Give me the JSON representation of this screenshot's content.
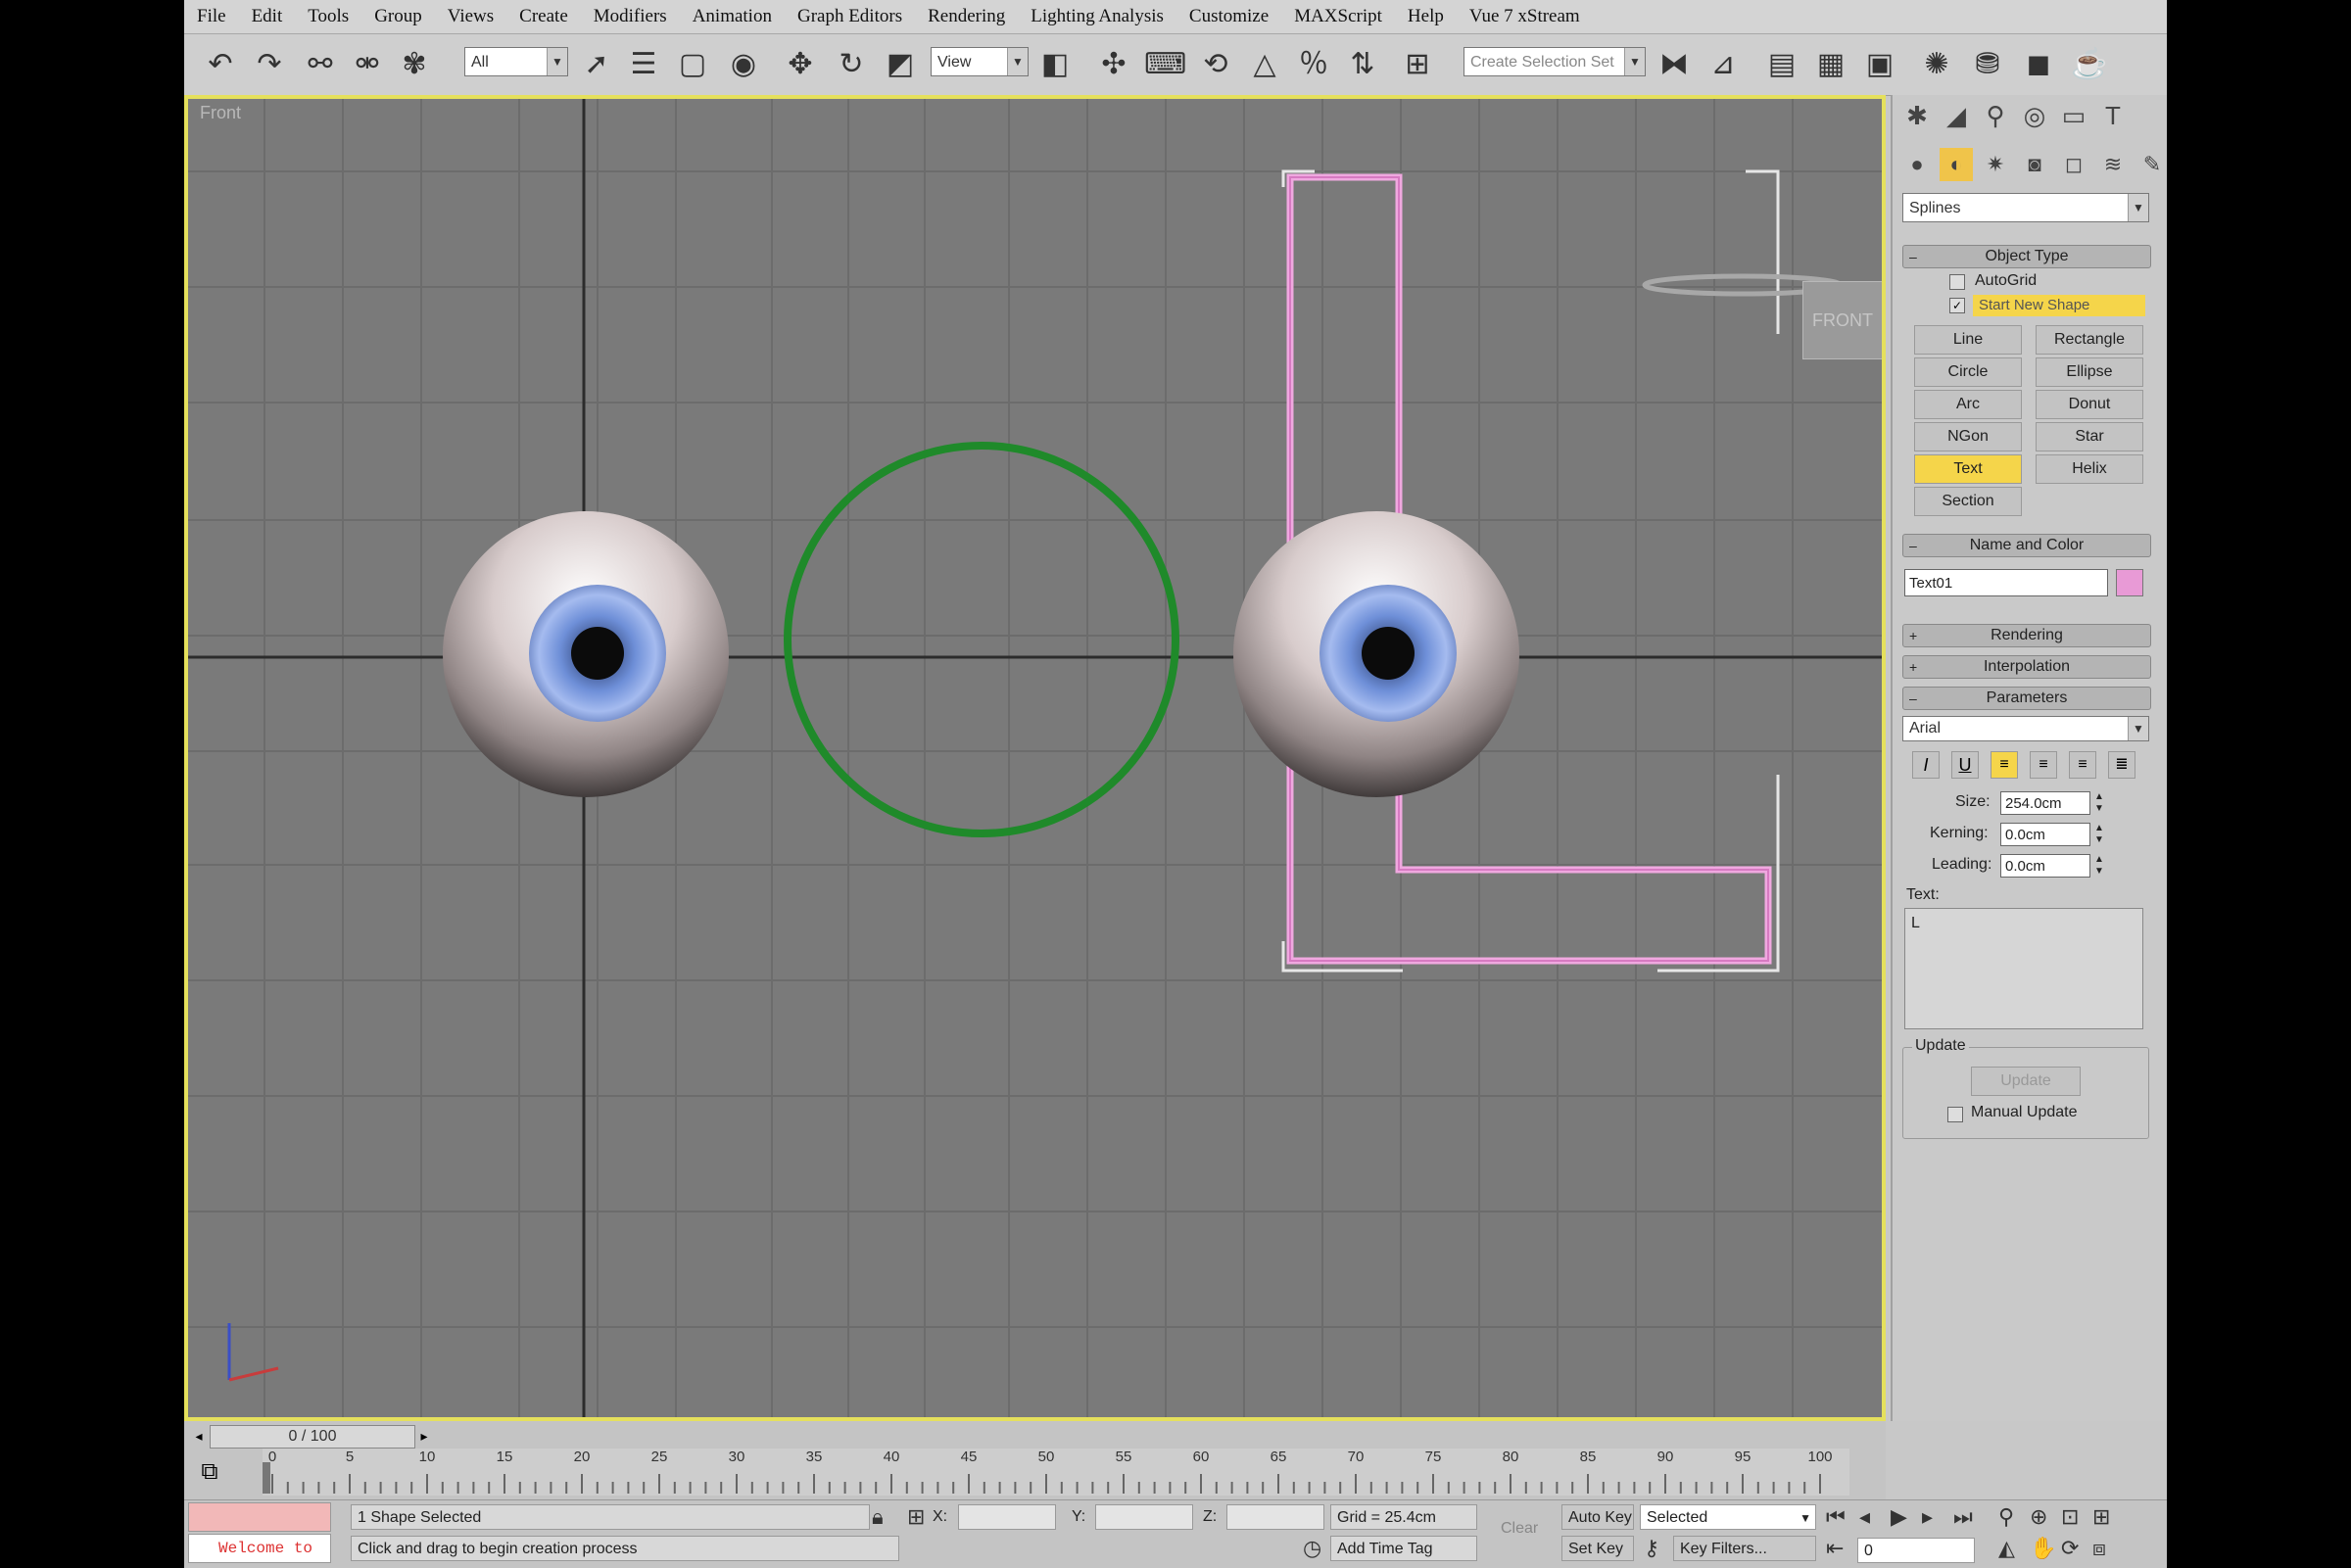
{
  "menu": [
    "File",
    "Edit",
    "Tools",
    "Group",
    "Views",
    "Create",
    "Modifiers",
    "Animation",
    "Graph Editors",
    "Rendering",
    "Lighting Analysis",
    "Customize",
    "MAXScript",
    "Help",
    "Vue 7 xStream"
  ],
  "toolbar": {
    "selection_filter": "All",
    "ref_coord": "View",
    "named_selection_placeholder": "Create Selection Set"
  },
  "viewport": {
    "label": "Front",
    "navcube_label": "FRONT"
  },
  "command_panel": {
    "category": "Splines",
    "object_type": {
      "title": "Object Type",
      "autogrid_label": "AutoGrid",
      "autogrid_checked": false,
      "start_new_shape_label": "Start New Shape",
      "start_new_shape_checked": true,
      "buttons": [
        "Line",
        "Rectangle",
        "Circle",
        "Ellipse",
        "Arc",
        "Donut",
        "NGon",
        "Star",
        "Text",
        "Helix",
        "Section"
      ],
      "active_button": "Text"
    },
    "name_and_color": {
      "title": "Name and Color",
      "object_name": "Text01",
      "color": "#e89ad6"
    },
    "rendering_title": "Rendering",
    "interpolation_title": "Interpolation",
    "parameters": {
      "title": "Parameters",
      "font": "Arial",
      "size_label": "Size:",
      "size_value": "254.0cm",
      "kerning_label": "Kerning:",
      "kerning_value": "0.0cm",
      "leading_label": "Leading:",
      "leading_value": "0.0cm",
      "text_label": "Text:",
      "text_value": "L"
    },
    "update": {
      "group_label": "Update",
      "button_label": "Update",
      "manual_update_label": "Manual Update",
      "manual_update_checked": false
    }
  },
  "timeline": {
    "slider_label": "0 / 100",
    "ticks": [
      "0",
      "5",
      "10",
      "15",
      "20",
      "25",
      "30",
      "35",
      "40",
      "45",
      "50",
      "55",
      "60",
      "65",
      "70",
      "75",
      "80",
      "85",
      "90",
      "95",
      "100"
    ]
  },
  "status": {
    "script_listener": "Welcome to",
    "selection_text": "1 Shape Selected",
    "prompt_text": "Click and drag to begin creation process",
    "x_label": "X:",
    "y_label": "Y:",
    "z_label": "Z:",
    "grid_text": "Grid = 25.4cm",
    "add_time_tag": "Add Time Tag",
    "auto_key": "Auto Key",
    "set_key": "Set Key",
    "key_mode": "Selected",
    "key_filters": "Key Filters...",
    "current_frame": "0",
    "clear_label": "Clear"
  },
  "colors": {
    "viewport_bg": "#7a7a7a",
    "active_border": "#e5e05c",
    "circle_stroke": "#1f8a2a",
    "text_spline": "#f0a8e0",
    "active_button": "#f5d54a"
  }
}
